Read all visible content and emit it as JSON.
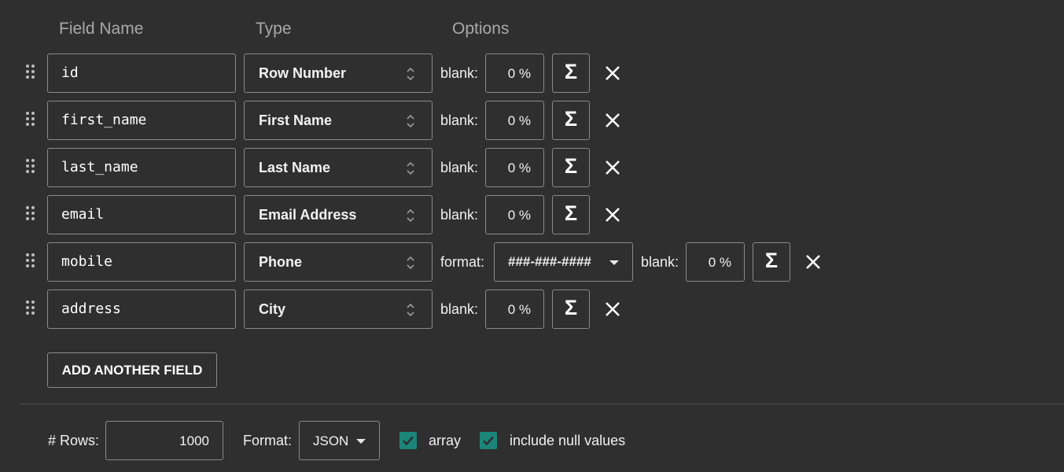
{
  "headers": {
    "field_name": "Field Name",
    "type": "Type",
    "options": "Options"
  },
  "labels": {
    "blank": "blank:",
    "format": "format:",
    "sigma": "Σ"
  },
  "fields": [
    {
      "name": "id",
      "type": "Row Number",
      "blank": "0 %"
    },
    {
      "name": "first_name",
      "type": "First Name",
      "blank": "0 %"
    },
    {
      "name": "last_name",
      "type": "Last Name",
      "blank": "0 %"
    },
    {
      "name": "email",
      "type": "Email Address",
      "blank": "0 %"
    },
    {
      "name": "mobile",
      "type": "Phone",
      "format": "###-###-####",
      "blank": "0 %"
    },
    {
      "name": "address",
      "type": "City",
      "blank": "0 %"
    }
  ],
  "add_field_label": "ADD ANOTHER FIELD",
  "footer": {
    "rows_label": "# Rows:",
    "rows_value": "1000",
    "format_label": "Format:",
    "format_value": "JSON",
    "array_label": "array",
    "array_checked": true,
    "null_label": "include null values",
    "null_checked": true
  },
  "colors": {
    "background": "#2f2f2f",
    "checkbox": "#1b857a",
    "border": "#8a8a8a"
  },
  "icons": [
    "drag-handle-icon",
    "updown-chevron-icon",
    "sigma-icon",
    "close-icon",
    "dropdown-caret-icon",
    "checkmark-icon"
  ]
}
